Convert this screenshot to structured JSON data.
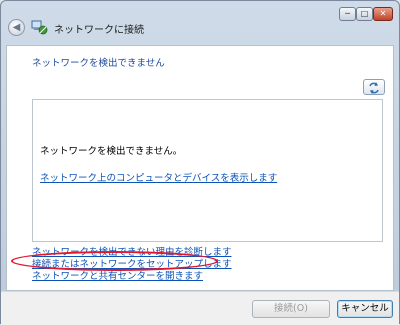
{
  "window": {
    "title": "ネットワークに接続",
    "controls": {
      "minimize": "─",
      "maximize": "□",
      "close": "✕"
    }
  },
  "main": {
    "heading": "ネットワークを検出できません",
    "panel": {
      "message": "ネットワークを検出できません。",
      "link": "ネットワーク上のコンピュータとデバイスを表示します"
    },
    "links": [
      "ネットワークを検出できない理由を診断します",
      "接続またはネットワークをセットアップします",
      "ネットワークと共有センターを開きます"
    ]
  },
  "footer": {
    "connect_label": "接続(O)",
    "cancel_label": "キャンセル"
  },
  "icons": {
    "back": "back-arrow-icon",
    "network": "network-icon",
    "refresh": "refresh-icon"
  },
  "colors": {
    "link": "#0b53b8",
    "heading": "#1f4b99",
    "highlight": "#e2182c"
  }
}
